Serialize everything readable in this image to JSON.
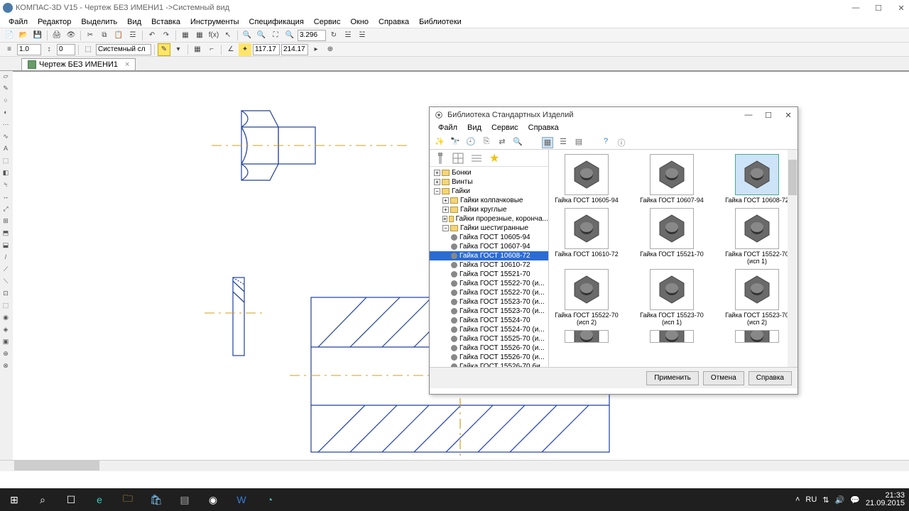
{
  "title": "КОМПАС-3D V15 - Чертеж БЕЗ ИМЕНИ1 ->Системный вид",
  "menu": [
    "Файл",
    "Редактор",
    "Выделить",
    "Вид",
    "Вставка",
    "Инструменты",
    "Спецификация",
    "Сервис",
    "Окно",
    "Справка",
    "Библиотеки"
  ],
  "tb2": {
    "scale": "1.0",
    "step": "0",
    "view": "Системный сл",
    "x": "117.17",
    "y": "214.17",
    "zoom": "3.296"
  },
  "tab": "Чертеж БЕЗ ИМЕНИ1",
  "lib": {
    "title": "Библиотека Стандартных Изделий",
    "menu": [
      "Файл",
      "Вид",
      "Сервис",
      "Справка"
    ],
    "tree_top": [
      "Бонки",
      "Винты",
      "Гайки"
    ],
    "tree_sub": [
      "Гайки колпачковые",
      "Гайки круглые",
      "Гайки прорезные, коронча...",
      "Гайки шестигранные"
    ],
    "tree_leaf": [
      "Гайка ГОСТ 10605-94",
      "Гайка ГОСТ 10607-94",
      "Гайка ГОСТ 10608-72",
      "Гайка ГОСТ 10610-72",
      "Гайка ГОСТ 15521-70",
      "Гайка ГОСТ 15522-70 (и...",
      "Гайка ГОСТ 15522-70 (и...",
      "Гайка ГОСТ 15523-70 (и...",
      "Гайка ГОСТ 15523-70 (и...",
      "Гайка ГОСТ 15524-70",
      "Гайка ГОСТ 15524-70 (и...",
      "Гайка ГОСТ 15525-70 (и...",
      "Гайка ГОСТ 15526-70 (и...",
      "Гайка ГОСТ 15526-70 (и...",
      "Гайка ГОСТ 15526-70 би..."
    ],
    "sel_leaf": 2,
    "gallery": [
      [
        "Гайка ГОСТ 10605-94",
        "Гайка ГОСТ 10607-94",
        "Гайка ГОСТ 10608-72"
      ],
      [
        "Гайка ГОСТ 10610-72",
        "Гайка ГОСТ 15521-70",
        "Гайка ГОСТ 15522-70 (исп 1)"
      ],
      [
        "Гайка ГОСТ 15522-70 (исп 2)",
        "Гайка ГОСТ 15523-70 (исп 1)",
        "Гайка ГОСТ 15523-70 (исп 2)"
      ]
    ],
    "sel_gallery": "0.2",
    "buttons": [
      "Применить",
      "Отмена",
      "Справка"
    ]
  },
  "tray": {
    "lang": "RU",
    "time": "21:33",
    "date": "21.09.2015"
  }
}
